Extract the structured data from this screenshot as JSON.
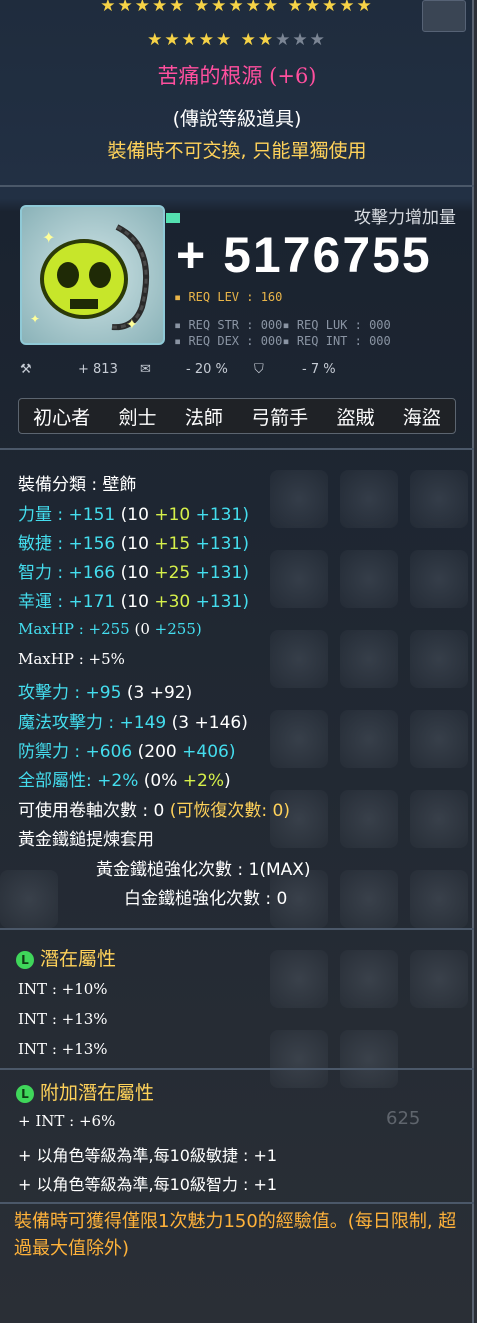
{
  "stars": {
    "row1": "★★★★★  ★★★★★  ★★★★★",
    "row2_gold": "★★★★★  ★★",
    "row2_grey": "★★★"
  },
  "item": {
    "name": "苦痛的根源 (+6)",
    "rank": "(傳說等級道具)",
    "trade": "裝備時不可交換, 只能單獨使用",
    "attack_label": "攻擊力增加量",
    "attack_value": "+ 5176755",
    "req_lev": "▪ REQ LEV :    160",
    "req_str": "▪ REQ STR :   000▪ REQ LUK :  000",
    "req_dex": "▪ REQ DEX :   000▪ REQ INT :  000",
    "sub1": "+ 813",
    "sub2": "- 20 %",
    "sub3": "- 7 %"
  },
  "jobs": [
    "初心者",
    "劍士",
    "法師",
    "弓箭手",
    "盜賊",
    "海盜"
  ],
  "stats": {
    "category": "裝備分類 : 壁飾",
    "str_label": "力量 : ",
    "str_total": "+151",
    "str_open": " (10 ",
    "str_green": "+10",
    "str_close": " +131)",
    "dex_label": "敏捷 : ",
    "dex_total": "+156",
    "dex_open": " (10 ",
    "dex_green": "+15",
    "dex_close": " +131)",
    "int_label": "智力 : ",
    "int_total": "+166",
    "int_open": " (10 ",
    "int_green": "+25",
    "int_close": " +131)",
    "luk_label": "幸運 : ",
    "luk_total": "+171",
    "luk_open": " (10 ",
    "luk_green": "+30",
    "luk_close": " +131)",
    "maxhp_label": "MaxHP : ",
    "maxhp_total": "+255",
    "maxhp_open": " (0 ",
    "maxhp_close": "+255)",
    "maxhp_pct": "MaxHP : +5%",
    "atk_label": "攻擊力 : ",
    "atk_total": "+95",
    "atk_rest": " (3 +92)",
    "matk_label": "魔法攻擊力 : ",
    "matk_total": "+149",
    "matk_rest": " (3 +146)",
    "def_label": "防禦力 : ",
    "def_total": "+606",
    "def_open": " (200 ",
    "def_close": "+406)",
    "all_label": "全部屬性: ",
    "all_total": "+2%",
    "all_open": " (0% ",
    "all_green": "+2%",
    "all_close": ")",
    "scroll_white": "可使用卷軸次數 : 0",
    "scroll_yellow": " (可恢復次數: 0)",
    "hammer_title": "黃金鐵鎚提煉套用",
    "hammer_gold": "黃金鐵槌強化次數 : 1(MAX)",
    "hammer_plat": "白金鐵槌強化次數 : 0"
  },
  "potential": {
    "title": "潛在屬性",
    "lines": [
      "INT : +10%",
      "INT : +13%",
      "INT : +13%"
    ]
  },
  "bonus_potential": {
    "title": "附加潛在屬性",
    "lines": [
      "+ INT : +6%",
      "+ 以角色等級為準,每10級敏捷 : +1",
      "+ 以角色等級為準,每10級智力 : +1"
    ]
  },
  "background_value": "625",
  "footer": "裝備時可獲得僅限1次魅力150的經驗值。(每日限制, 超過最大值除外)"
}
